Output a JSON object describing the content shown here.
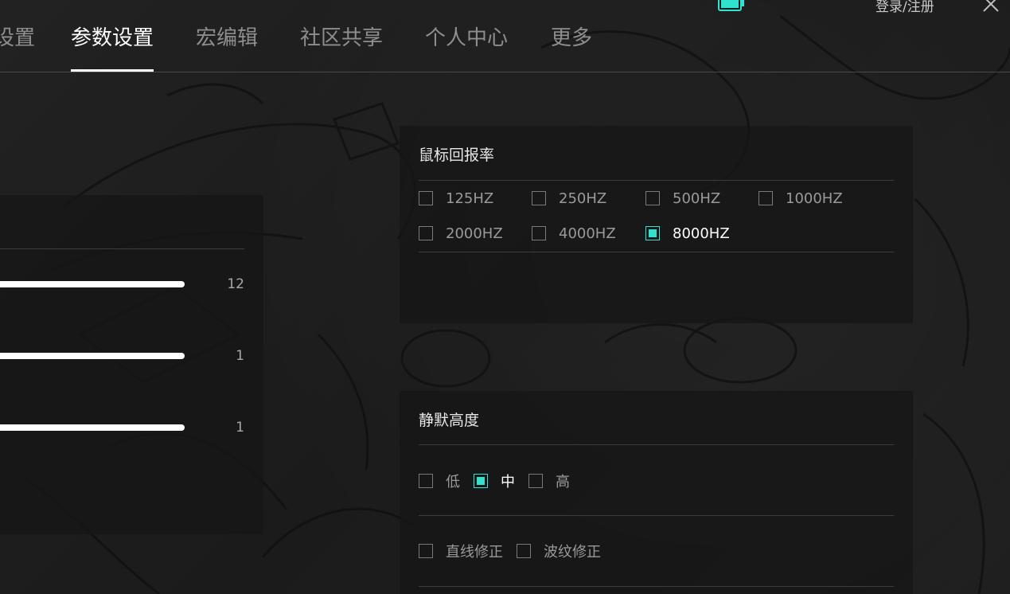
{
  "nav": {
    "tabs": [
      {
        "label": "设置",
        "active": false
      },
      {
        "label": "参数设置",
        "active": true
      },
      {
        "label": "宏编辑",
        "active": false
      },
      {
        "label": "社区共享",
        "active": false
      },
      {
        "label": "个人中心",
        "active": false
      },
      {
        "label": "更多",
        "active": false
      }
    ],
    "login_label": "登录/注册",
    "battery_icon": "battery-icon",
    "close_icon": "close-icon"
  },
  "left_panel": {
    "sliders": [
      {
        "value": "12"
      },
      {
        "value": "1"
      },
      {
        "value": "1"
      }
    ]
  },
  "polling_rate": {
    "title": "鼠标回报率",
    "options": [
      {
        "label": "125HZ",
        "checked": false
      },
      {
        "label": "250HZ",
        "checked": false
      },
      {
        "label": "500HZ",
        "checked": false
      },
      {
        "label": "1000HZ",
        "checked": false
      },
      {
        "label": "2000HZ",
        "checked": false
      },
      {
        "label": "4000HZ",
        "checked": false
      },
      {
        "label": "8000HZ",
        "checked": true
      }
    ]
  },
  "silent_height": {
    "title": "静默高度",
    "levels": [
      {
        "label": "低",
        "checked": false
      },
      {
        "label": "中",
        "checked": true
      },
      {
        "label": "高",
        "checked": false
      }
    ],
    "corrections": [
      {
        "label": "直线修正",
        "checked": false
      },
      {
        "label": "波纹修正",
        "checked": false
      }
    ]
  },
  "colors": {
    "accent": "#2fe3cf",
    "panel_bg": "#161616",
    "text_active": "#ffffff",
    "text_inactive": "#8e8e8e"
  }
}
